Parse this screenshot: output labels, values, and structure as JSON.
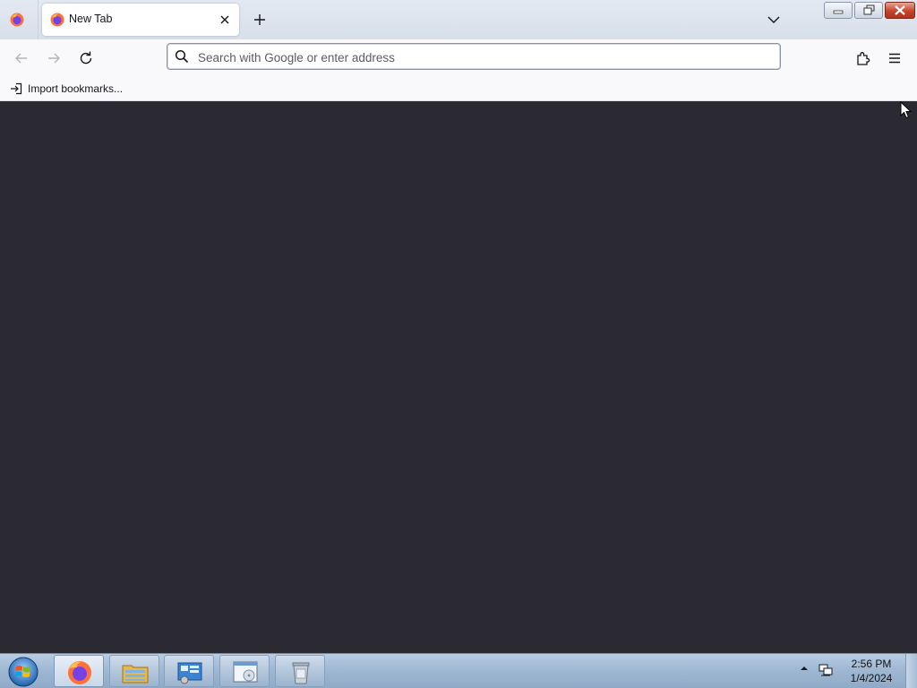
{
  "window": {
    "tabs": [
      {
        "label": "New Tab",
        "active": true
      }
    ],
    "controls": [
      "minimize",
      "restore",
      "close"
    ]
  },
  "navbar": {
    "back_icon": "arrow-left-icon",
    "forward_icon": "arrow-right-icon",
    "reload_icon": "reload-icon",
    "url_placeholder": "Search with Google or enter address",
    "url_value": "",
    "extensions_icon": "puzzle-icon",
    "menu_icon": "hamburger-menu-icon"
  },
  "bookmarks": {
    "import_label": "Import bookmarks..."
  },
  "content": {
    "background": "#2b2a33"
  },
  "taskbar": {
    "items": [
      "start-button",
      "firefox",
      "file-explorer",
      "control-panel",
      "window-app",
      "recycle-app"
    ],
    "clock_time": "2:56 PM",
    "clock_date": "1/4/2024"
  },
  "colors": {
    "accent": "#0061e0",
    "tabstrip": "#dfe6ef",
    "toolbar": "#f9f9fb",
    "content": "#2b2a33"
  }
}
